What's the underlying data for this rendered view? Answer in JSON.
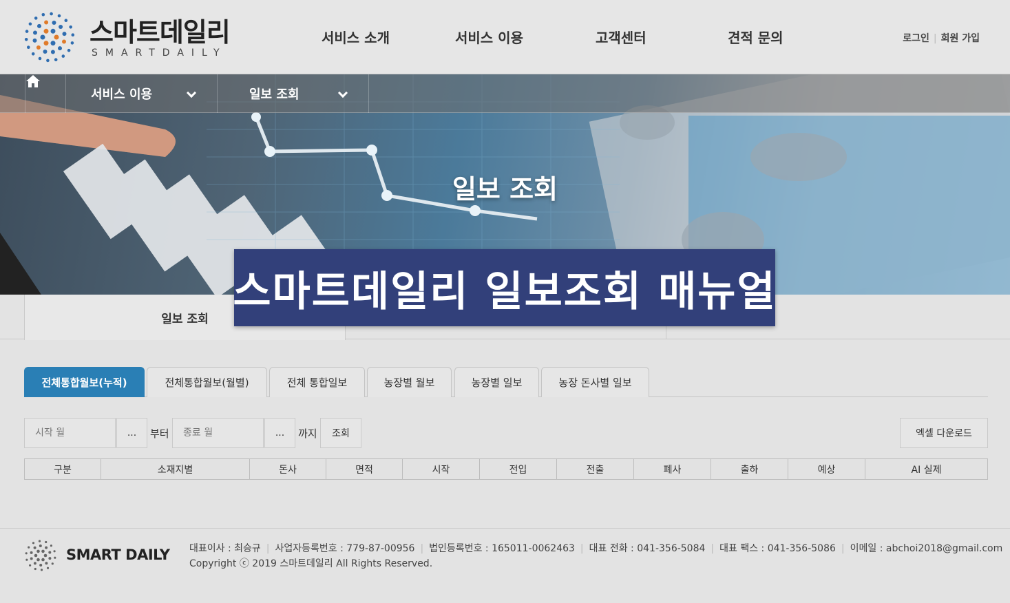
{
  "header": {
    "logo_kr": "스마트데일리",
    "logo_en": "SMARTDAILY",
    "nav": [
      "서비스 소개",
      "서비스 이용",
      "고객센터",
      "견적 문의"
    ],
    "login": "로그인",
    "signup": "회원 가입"
  },
  "breadcrumb": {
    "items": [
      "서비스 이용",
      "일보 조회"
    ]
  },
  "banner": {
    "title": "일보 조회"
  },
  "overlay": {
    "text": "스마트데일리 일보조회 매뉴얼"
  },
  "section_tabs": {
    "active": "일보 조회"
  },
  "report_tabs": [
    {
      "label": "전체통합월보(누적)",
      "active": true
    },
    {
      "label": "전체통합월보(월별)",
      "active": false
    },
    {
      "label": "전체 통합일보",
      "active": false
    },
    {
      "label": "농장별 월보",
      "active": false
    },
    {
      "label": "농장별 일보",
      "active": false
    },
    {
      "label": "농장 돈사별 일보",
      "active": false
    }
  ],
  "filter": {
    "start_placeholder": "시작 월",
    "end_placeholder": "종료 월",
    "picker_label": "...",
    "from_text": "부터",
    "to_text": "까지",
    "search_label": "조회",
    "excel_label": "엑셀 다운로드"
  },
  "table": {
    "columns": [
      "구분",
      "소재지별",
      "돈사",
      "면적",
      "시작",
      "전입",
      "전출",
      "폐사",
      "출하",
      "예상",
      "AI 실제"
    ]
  },
  "footer": {
    "logo_text": "SMART DAILY",
    "info": [
      "대표이사 : 최승규",
      "사업자등록번호 : 779-87-00956",
      "법인등록번호 : 165011-0062463",
      "대표 전화 : 041-356-5084",
      "대표 팩스 : 041-356-5086",
      "이메일 : abchoi2018@gmail.com"
    ],
    "copyright": "Copyright ⓒ 2019 스마트데일리 All Rights Reserved."
  },
  "colors": {
    "accent": "#2a7fb5",
    "overlay_bg": "#32407a",
    "logo_blue": "#2f6db0",
    "logo_orange": "#e07b2a"
  }
}
